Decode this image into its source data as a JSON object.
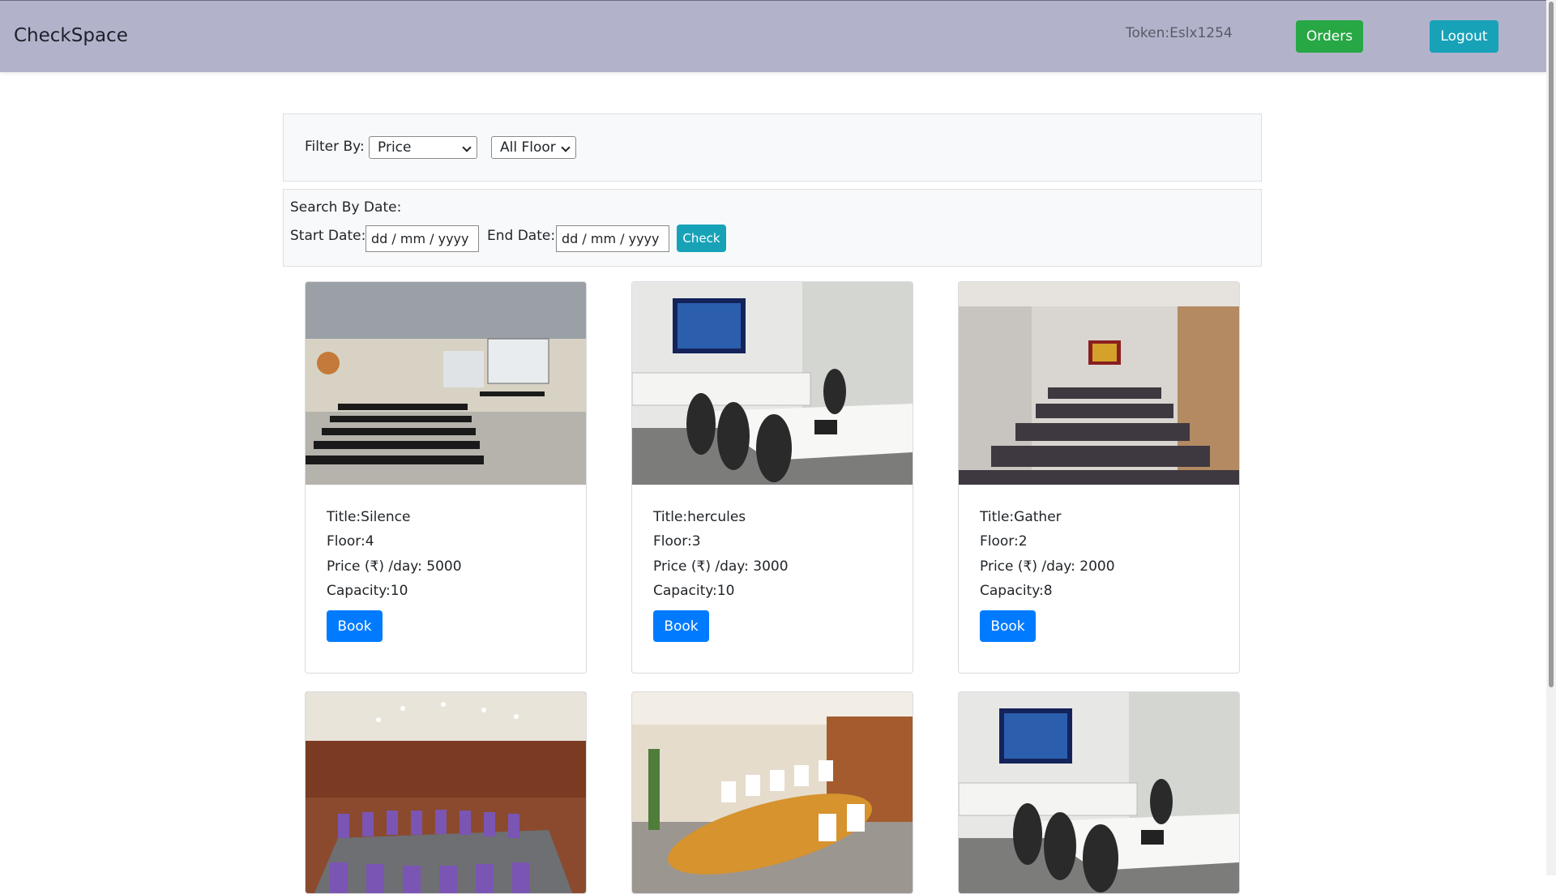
{
  "navbar": {
    "brand": "CheckSpace",
    "token": "Token:Eslx1254",
    "orders_label": "Orders",
    "logout_label": "Logout"
  },
  "filter": {
    "label": "Filter By:",
    "price_select": "Price",
    "floor_select": "All Floor"
  },
  "search": {
    "heading": "Search By Date:",
    "start_label": "Start Date:",
    "start_value": "dd / mm / yyyy",
    "end_label": "End Date:",
    "end_value": "dd / mm / yyyy",
    "check_label": "Check"
  },
  "rooms": [
    {
      "title": "Title:Silence",
      "floor": "Floor:4",
      "price": "Price (₹) /day: 5000",
      "capacity": "Capacity:10",
      "book": "Book"
    },
    {
      "title": "Title:hercules",
      "floor": "Floor:3",
      "price": "Price (₹) /day: 3000",
      "capacity": "Capacity:10",
      "book": "Book"
    },
    {
      "title": "Title:Gather",
      "floor": "Floor:2",
      "price": "Price (₹) /day: 2000",
      "capacity": "Capacity:8",
      "book": "Book"
    }
  ],
  "colors": {
    "navbar": "#b2b3cb",
    "orders": "#28a745",
    "logout": "#17a2b8",
    "book": "#007bff"
  }
}
